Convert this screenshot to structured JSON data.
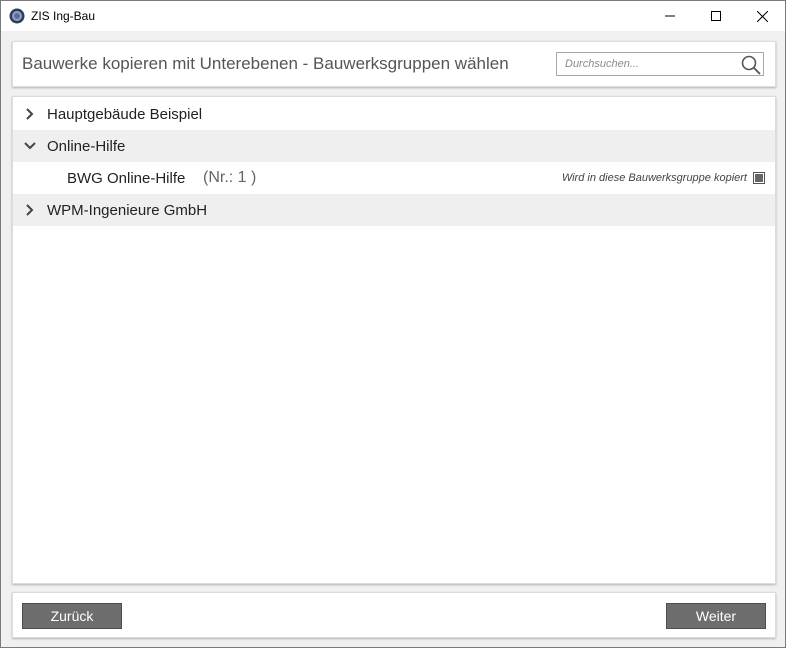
{
  "window": {
    "title": "ZIS Ing-Bau"
  },
  "header": {
    "title": "Bauwerke kopieren mit Unterebenen - Bauwerksgruppen wählen",
    "search_placeholder": "Durchsuchen..."
  },
  "tree": {
    "groups": [
      {
        "label": "Hauptgebäude Beispiel",
        "expanded": false
      },
      {
        "label": "Online-Hilfe",
        "expanded": true,
        "children": [
          {
            "label": "BWG Online-Hilfe",
            "nr": "(Nr.: 1 )",
            "note": "Wird in diese Bauwerksgruppe kopiert",
            "checked": true
          }
        ]
      },
      {
        "label": "WPM-Ingenieure GmbH",
        "expanded": false
      }
    ]
  },
  "footer": {
    "back_label": "Zurück",
    "next_label": "Weiter"
  },
  "colors": {
    "button_bg": "#6d6d6d",
    "row_alt_bg": "#efefef",
    "title_text": "#555555"
  }
}
